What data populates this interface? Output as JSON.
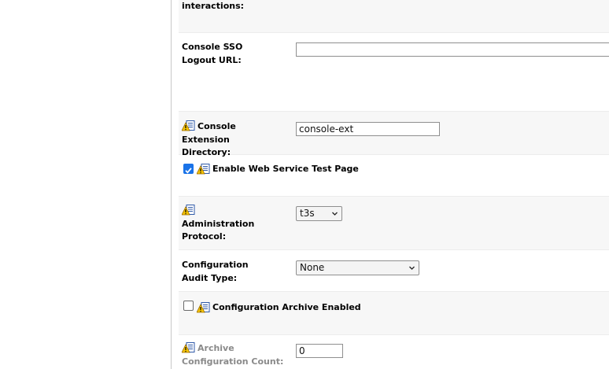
{
  "fields": {
    "interactions_label": "interactions:",
    "sso_logout": {
      "label": "Console SSO Logout URL:",
      "value": ""
    },
    "ext_dir": {
      "label": "Console Extension Directory:",
      "value": "console-ext"
    },
    "web_service_test": {
      "label": "Enable Web Service Test Page",
      "checked": true
    },
    "admin_protocol": {
      "label": "Administration Protocol:",
      "value": "t3s"
    },
    "audit_type": {
      "label": "Configuration Audit Type:",
      "value": "None"
    },
    "archive_enabled": {
      "label": "Configuration Archive Enabled",
      "checked": false
    },
    "archive_count": {
      "label": "Archive Configuration Count:",
      "value": "0"
    }
  },
  "colors": {
    "checkbox_on": "#1a73e8",
    "row_shade": "#f7f7f7",
    "dim_label": "#8a8a8a"
  },
  "icons": {
    "config_icon": "warning-config-icon"
  }
}
